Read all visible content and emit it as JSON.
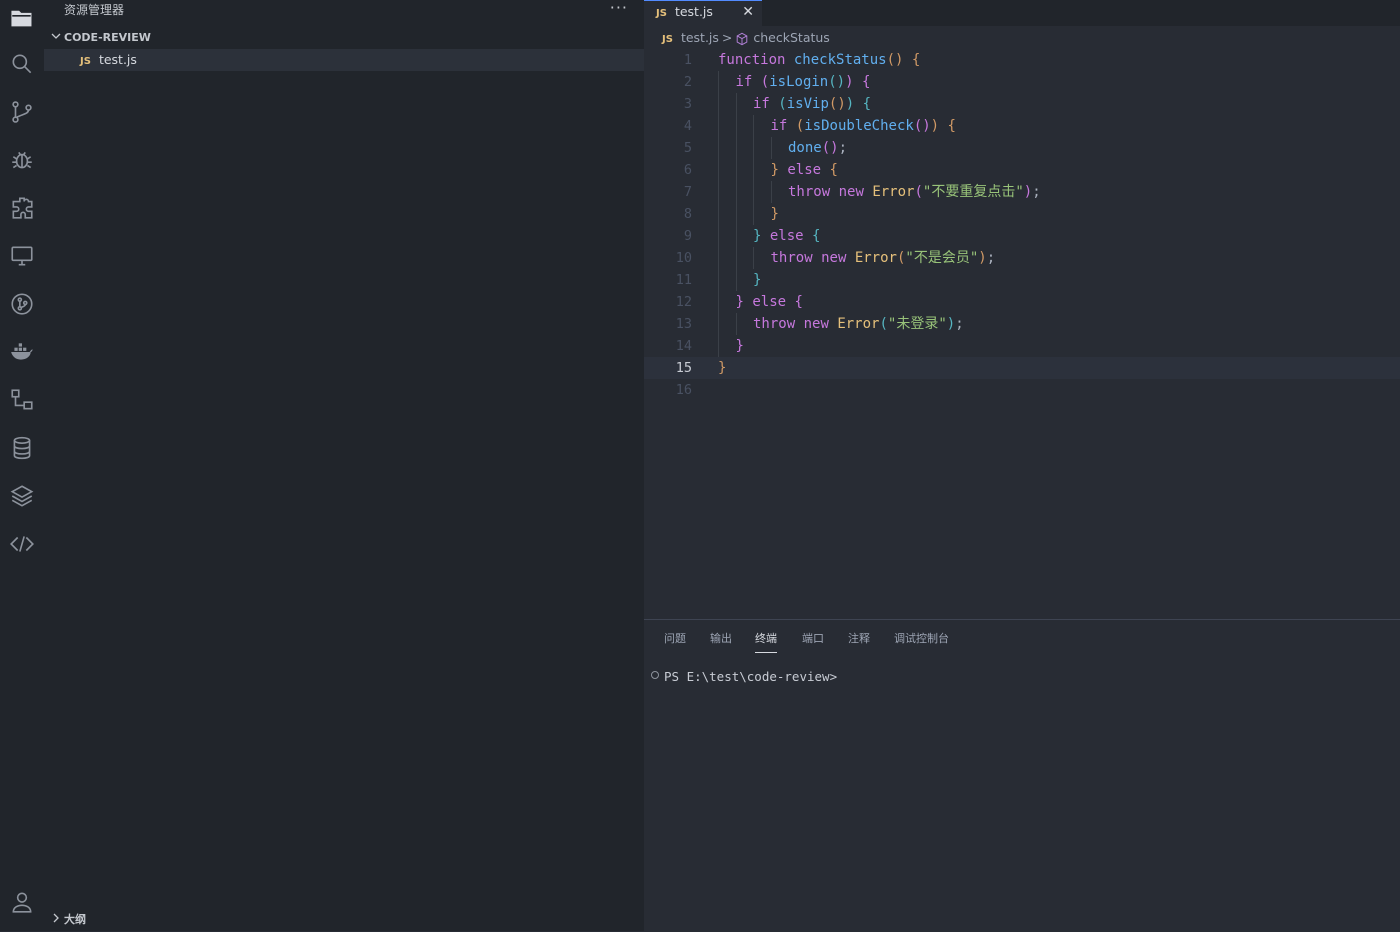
{
  "sidebar": {
    "title": "资源管理器",
    "more": "···",
    "section": "CODE-REVIEW",
    "file": {
      "badge": "JS",
      "name": "test.js"
    },
    "outline": "大纲"
  },
  "activity_bar": {
    "icons": [
      "files-icon",
      "search-icon",
      "source-control-icon",
      "debug-icon",
      "extensions-icon",
      "remote-explorer-icon",
      "git-graph-icon",
      "docker-icon",
      "flow-icon",
      "database-icon",
      "layers-icon",
      "live-share-icon",
      "account-icon"
    ]
  },
  "tab": {
    "badge": "JS",
    "name": "test.js",
    "close": "✕"
  },
  "breadcrumb": {
    "badge": "JS",
    "file": "test.js",
    "sep": ">",
    "symbol": "checkStatus"
  },
  "editor": {
    "line_numbers": [
      "1",
      "2",
      "3",
      "4",
      "5",
      "6",
      "7",
      "8",
      "9",
      "10",
      "11",
      "12",
      "13",
      "14",
      "15",
      "16"
    ],
    "current_line": 15,
    "lines": [
      [
        [
          "kw",
          "function"
        ],
        [
          "pn",
          " "
        ],
        [
          "fn",
          "checkStatus"
        ],
        [
          "b1",
          "()"
        ],
        [
          "pn",
          " "
        ],
        [
          "b1",
          "{"
        ]
      ],
      [
        [
          "kw",
          "if"
        ],
        [
          "pn",
          " "
        ],
        [
          "b2",
          "("
        ],
        [
          "fn",
          "isLogin"
        ],
        [
          "b3",
          "()"
        ],
        [
          "b2",
          ")"
        ],
        [
          "pn",
          " "
        ],
        [
          "b2",
          "{"
        ]
      ],
      [
        [
          "kw",
          "if"
        ],
        [
          "pn",
          " "
        ],
        [
          "b3",
          "("
        ],
        [
          "fn",
          "isVip"
        ],
        [
          "b1",
          "()"
        ],
        [
          "b3",
          ")"
        ],
        [
          "pn",
          " "
        ],
        [
          "b3",
          "{"
        ]
      ],
      [
        [
          "kw",
          "if"
        ],
        [
          "pn",
          " "
        ],
        [
          "b1",
          "("
        ],
        [
          "fn",
          "isDoubleCheck"
        ],
        [
          "b2",
          "()"
        ],
        [
          "b1",
          ")"
        ],
        [
          "pn",
          " "
        ],
        [
          "b1",
          "{"
        ]
      ],
      [
        [
          "fn",
          "done"
        ],
        [
          "b2",
          "()"
        ],
        [
          "pn",
          ";"
        ]
      ],
      [
        [
          "b1",
          "}"
        ],
        [
          "pn",
          " "
        ],
        [
          "kw",
          "else"
        ],
        [
          "pn",
          " "
        ],
        [
          "b1",
          "{"
        ]
      ],
      [
        [
          "kw",
          "throw"
        ],
        [
          "pn",
          " "
        ],
        [
          "kw",
          "new"
        ],
        [
          "pn",
          " "
        ],
        [
          "cls",
          "Error"
        ],
        [
          "b2",
          "("
        ],
        [
          "str",
          "\"不要重复点击\""
        ],
        [
          "b2",
          ")"
        ],
        [
          "pn",
          ";"
        ]
      ],
      [
        [
          "b1",
          "}"
        ]
      ],
      [
        [
          "b3",
          "}"
        ],
        [
          "pn",
          " "
        ],
        [
          "kw",
          "else"
        ],
        [
          "pn",
          " "
        ],
        [
          "b3",
          "{"
        ]
      ],
      [
        [
          "kw",
          "throw"
        ],
        [
          "pn",
          " "
        ],
        [
          "kw",
          "new"
        ],
        [
          "pn",
          " "
        ],
        [
          "cls",
          "Error"
        ],
        [
          "b1",
          "("
        ],
        [
          "str",
          "\"不是会员\""
        ],
        [
          "b1",
          ")"
        ],
        [
          "pn",
          ";"
        ]
      ],
      [
        [
          "b3",
          "}"
        ]
      ],
      [
        [
          "b2",
          "}"
        ],
        [
          "pn",
          " "
        ],
        [
          "kw",
          "else"
        ],
        [
          "pn",
          " "
        ],
        [
          "b2",
          "{"
        ]
      ],
      [
        [
          "kw",
          "throw"
        ],
        [
          "pn",
          " "
        ],
        [
          "kw",
          "new"
        ],
        [
          "pn",
          " "
        ],
        [
          "cls",
          "Error"
        ],
        [
          "b3",
          "("
        ],
        [
          "str",
          "\"未登录\""
        ],
        [
          "b3",
          ")"
        ],
        [
          "pn",
          ";"
        ]
      ],
      [
        [
          "b2",
          "}"
        ]
      ],
      [
        [
          "b1",
          "}"
        ]
      ],
      []
    ]
  },
  "panel": {
    "tabs": [
      "问题",
      "输出",
      "终端",
      "端口",
      "注释",
      "调试控制台"
    ],
    "active_tab": "终端",
    "terminal_prompt": "PS E:\\test\\code-review>"
  },
  "colors": {
    "accent": "#528bff",
    "keyword": "#c678dd",
    "function": "#61afef",
    "class": "#e5c07b",
    "string": "#98c379"
  }
}
